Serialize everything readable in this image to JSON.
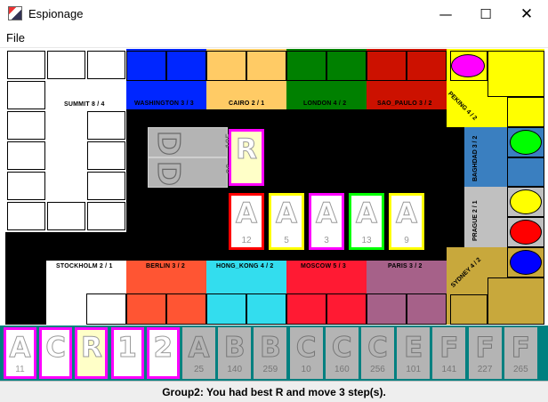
{
  "window": {
    "title": "Espionage",
    "minimize_glyph": "—",
    "maximize_glyph": "☐",
    "close_glyph": "✕"
  },
  "menu": {
    "file": "File"
  },
  "colors": {
    "washington": "#0026ff",
    "cairo": "#ffcb65",
    "london": "#008000",
    "sao_paulo": "#cc1100",
    "peking": "#ffff00",
    "baghdad": "#3a7fc0",
    "prague": "#c0c0c0",
    "sydney": "#c8a83c",
    "berlin": "#ff5533",
    "hong_kong": "#33ddee",
    "moscow": "#ff1a33",
    "paris": "#a66189",
    "summit": "#ffffff",
    "stockholm": "#ffffff",
    "hand_bg": "#008080"
  },
  "board": {
    "summit_label": "SUMMIT 8 / 4",
    "stockholm_label": "STOCKHOLM 2 / 1",
    "top_cities": [
      {
        "label": "WASHINGTON 3 / 3"
      },
      {
        "label": "CAIRO 2 / 1"
      },
      {
        "label": "LONDON 4 / 2"
      },
      {
        "label": "SAO_PAULO 3 / 2"
      }
    ],
    "bottom_cities": [
      {
        "label": "BERLIN 3 / 2"
      },
      {
        "label": "HONG_KONG 4 / 2"
      },
      {
        "label": "MOSCOW 5 / 3"
      },
      {
        "label": "PARIS 3 / 2"
      }
    ],
    "right_cities": [
      {
        "label": "PEKING 4 / 2"
      },
      {
        "label": "BAGHDAD 3 / 2"
      },
      {
        "label": "PRAGUE 2 / 1"
      },
      {
        "label": "SYDNEY 4 / 2"
      }
    ],
    "tokens": [
      {
        "name": "magenta-token",
        "color": "#ff00ff"
      },
      {
        "name": "green-token",
        "color": "#00ff00"
      },
      {
        "name": "yellow-token",
        "color": "#ffff00"
      },
      {
        "name": "red-token",
        "color": "#ff0000"
      },
      {
        "name": "blue-token",
        "color": "#0000ff"
      }
    ]
  },
  "deck": [
    {
      "letter": "D",
      "number": "195"
    },
    {
      "letter": "D",
      "number": "96"
    }
  ],
  "revealed_card": {
    "letter": "R"
  },
  "played_cards": [
    {
      "letter": "A",
      "number": "12",
      "border": "#ff0000"
    },
    {
      "letter": "A",
      "number": "5",
      "border": "#ffff00"
    },
    {
      "letter": "A",
      "number": "3",
      "border": "#ff00ff"
    },
    {
      "letter": "A",
      "number": "13",
      "border": "#00ff00"
    },
    {
      "letter": "A",
      "number": "9",
      "border": "#ffff00"
    }
  ],
  "hand": [
    {
      "letter": "A",
      "number": "11",
      "style": "white"
    },
    {
      "letter": "C",
      "number": "",
      "style": "white"
    },
    {
      "letter": "R",
      "number": "",
      "style": "yellow"
    },
    {
      "letter": "1",
      "number": "",
      "style": "white"
    },
    {
      "letter": "2",
      "number": "",
      "style": "white"
    },
    {
      "letter": "A",
      "number": "25",
      "style": "gray"
    },
    {
      "letter": "B",
      "number": "140",
      "style": "gray"
    },
    {
      "letter": "B",
      "number": "259",
      "style": "gray"
    },
    {
      "letter": "C",
      "number": "10",
      "style": "gray"
    },
    {
      "letter": "C",
      "number": "160",
      "style": "gray"
    },
    {
      "letter": "C",
      "number": "256",
      "style": "gray"
    },
    {
      "letter": "E",
      "number": "101",
      "style": "gray"
    },
    {
      "letter": "F",
      "number": "141",
      "style": "gray"
    },
    {
      "letter": "F",
      "number": "227",
      "style": "gray"
    },
    {
      "letter": "F",
      "number": "265",
      "style": "gray"
    }
  ],
  "status": "Group2:  You had best R and move 3 step(s)."
}
